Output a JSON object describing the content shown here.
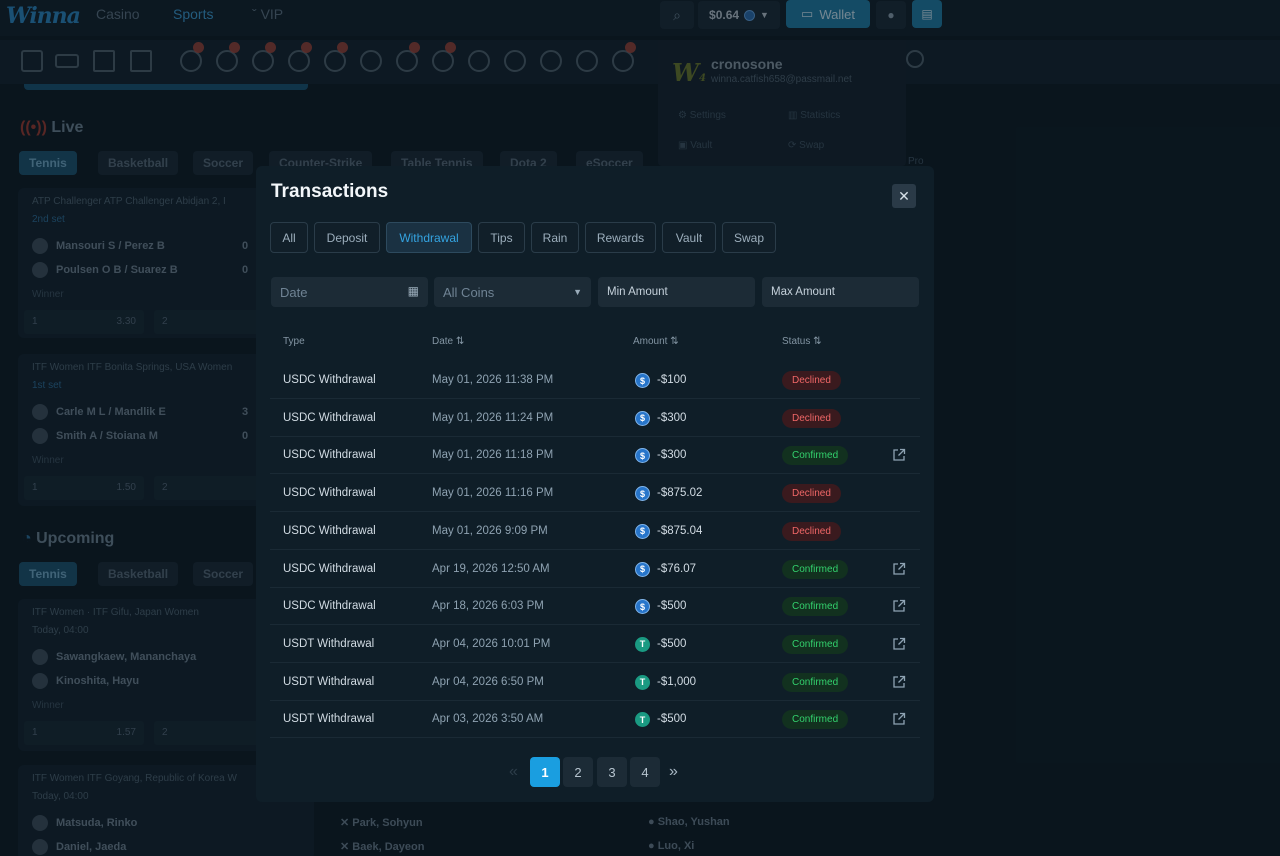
{
  "topbar": {
    "logo": "Winna",
    "tabs": [
      "Casino",
      "Sports",
      "VIP"
    ],
    "balance": "$0.64",
    "wallet_label": "Wallet"
  },
  "background": {
    "live_title": "Live",
    "upcoming_title": "Upcoming",
    "live_filters": [
      "Tennis",
      "Basketball",
      "Soccer",
      "Counter-Strike",
      "Table Tennis",
      "Dota 2",
      "eSoccer"
    ],
    "upcoming_filters": [
      "Tennis",
      "Basketball",
      "Soccer"
    ],
    "cards": [
      {
        "header": "ATP Challenger ATP Challenger Abidjan 2, I",
        "sub": "2nd set",
        "teams": [
          [
            "Mansouri S / Perez B",
            "0"
          ],
          [
            "Poulsen O B / Suarez B",
            "0"
          ]
        ],
        "winner": "Winner",
        "odds": [
          [
            "1",
            "3.30"
          ],
          [
            "2",
            ""
          ]
        ]
      },
      {
        "header": "ITF Women ITF Bonita Springs, USA Women",
        "sub": "1st set",
        "teams": [
          [
            "Carle M L / Mandlik E",
            "3"
          ],
          [
            "Smith A / Stoiana M",
            "0"
          ]
        ],
        "winner": "Winner",
        "odds": [
          [
            "1",
            "1.50"
          ],
          [
            "2",
            "2"
          ]
        ]
      },
      {
        "header": "ITF Women · ITF Gifu, Japan Women",
        "sub": "Today, 04:00",
        "teams": [
          [
            "Sawangkaew, Mananchaya",
            ""
          ],
          [
            "Kinoshita, Hayu",
            ""
          ]
        ],
        "winner": "Winner",
        "odds": [
          [
            "1",
            "1.57"
          ],
          [
            "2",
            "2"
          ]
        ]
      },
      {
        "header": "ITF Women ITF Goyang, Republic of Korea W",
        "sub": "Today, 04:00",
        "teams": [
          [
            "Matsuda, Rinko",
            ""
          ],
          [
            "Daniel, Jaeda",
            ""
          ]
        ],
        "winner": "",
        "odds": []
      }
    ],
    "mid_players": [
      "Park, Sohyun",
      "Baek, Dayeon"
    ],
    "right_players": [
      "Shao, Yushan",
      "Luo, Xi"
    ],
    "profile": {
      "level": "4",
      "username": "cronosone",
      "email": "winna.catfish658@passmail.net",
      "menu": [
        "Settings",
        "Statistics",
        "Vault",
        "Swap"
      ],
      "extra": "Pro"
    }
  },
  "modal": {
    "title": "Transactions",
    "close": "✕",
    "filter_tabs": [
      "All",
      "Deposit",
      "Withdrawal",
      "Tips",
      "Rain",
      "Rewards",
      "Vault",
      "Swap"
    ],
    "active_tab": "Withdrawal",
    "filters": {
      "date_placeholder": "Date",
      "coin_select": "All Coins",
      "min_placeholder": "Min Amount",
      "max_placeholder": "Max Amount"
    },
    "columns": [
      "Type",
      "Date ⇅",
      "Amount ⇅",
      "Status ⇅"
    ],
    "rows": [
      {
        "type": "USDC Withdrawal",
        "date": "May 01, 2026 11:38 PM",
        "coin": "usdc",
        "amount": "-$100",
        "status": "Declined",
        "link": false
      },
      {
        "type": "USDC Withdrawal",
        "date": "May 01, 2026 11:24 PM",
        "coin": "usdc",
        "amount": "-$300",
        "status": "Declined",
        "link": false
      },
      {
        "type": "USDC Withdrawal",
        "date": "May 01, 2026 11:18 PM",
        "coin": "usdc",
        "amount": "-$300",
        "status": "Confirmed",
        "link": true
      },
      {
        "type": "USDC Withdrawal",
        "date": "May 01, 2026 11:16 PM",
        "coin": "usdc",
        "amount": "-$875.02",
        "status": "Declined",
        "link": false
      },
      {
        "type": "USDC Withdrawal",
        "date": "May 01, 2026 9:09 PM",
        "coin": "usdc",
        "amount": "-$875.04",
        "status": "Declined",
        "link": false
      },
      {
        "type": "USDC Withdrawal",
        "date": "Apr 19, 2026 12:50 AM",
        "coin": "usdc",
        "amount": "-$76.07",
        "status": "Confirmed",
        "link": true
      },
      {
        "type": "USDC Withdrawal",
        "date": "Apr 18, 2026 6:03 PM",
        "coin": "usdc",
        "amount": "-$500",
        "status": "Confirmed",
        "link": true
      },
      {
        "type": "USDT Withdrawal",
        "date": "Apr 04, 2026 10:01 PM",
        "coin": "usdt",
        "amount": "-$500",
        "status": "Confirmed",
        "link": true
      },
      {
        "type": "USDT Withdrawal",
        "date": "Apr 04, 2026 6:50 PM",
        "coin": "usdt",
        "amount": "-$1,000",
        "status": "Confirmed",
        "link": true
      },
      {
        "type": "USDT Withdrawal",
        "date": "Apr 03, 2026 3:50 AM",
        "coin": "usdt",
        "amount": "-$500",
        "status": "Confirmed",
        "link": true
      }
    ],
    "pagination": {
      "pages": [
        "1",
        "2",
        "3",
        "4"
      ],
      "current": "1",
      "prev": "«",
      "next": "»"
    }
  },
  "colors": {
    "accent": "#1a9ee0",
    "declined": "#f06767",
    "confirmed": "#33d16d",
    "background": "#0e1c26"
  }
}
